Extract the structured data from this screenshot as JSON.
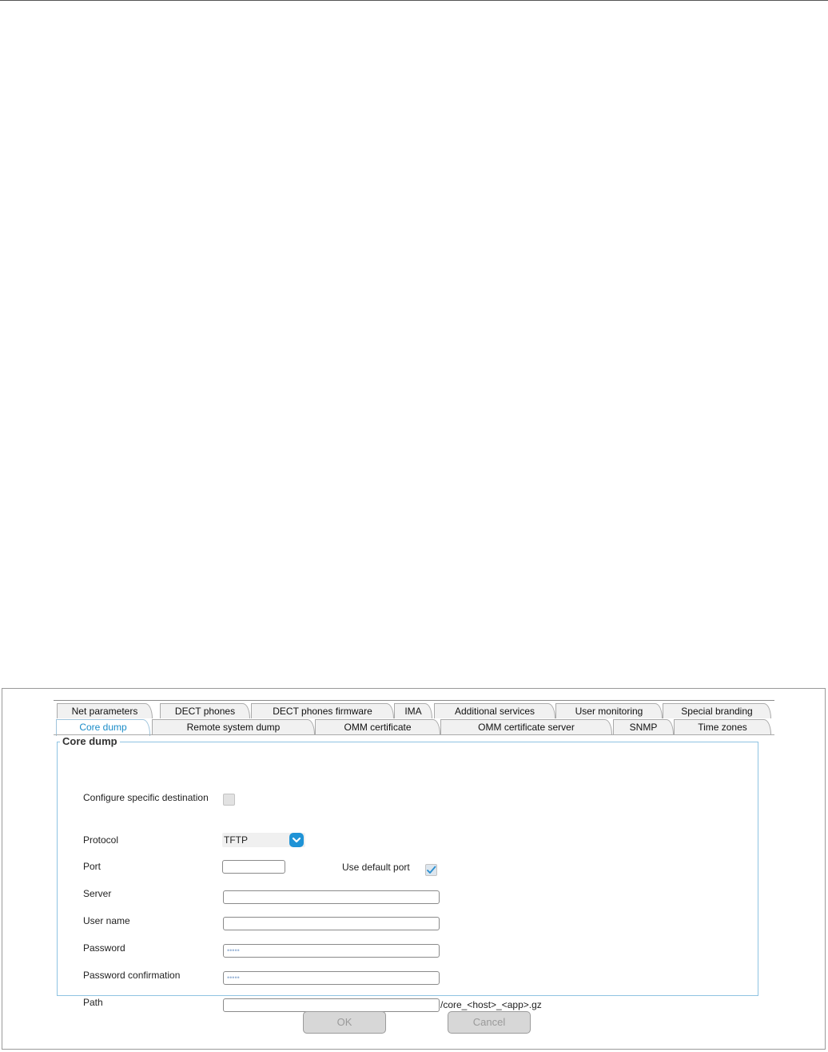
{
  "tabs": {
    "row1": [
      "Net parameters",
      "DECT phones",
      "DECT phones firmware",
      "IMA",
      "Additional services",
      "User monitoring",
      "Special branding"
    ],
    "row2": [
      "Core dump",
      "Remote system dump",
      "OMM certificate",
      "OMM certificate server",
      "SNMP",
      "Time zones"
    ],
    "active": "Core dump"
  },
  "group": {
    "title": "Core dump"
  },
  "form": {
    "configure_label": "Configure specific destination",
    "configure_checked": false,
    "protocol_label": "Protocol",
    "protocol_value": "TFTP",
    "port_label": "Port",
    "port_value": "",
    "use_default_port_label": "Use default port",
    "use_default_port_checked": true,
    "server_label": "Server",
    "server_value": "",
    "user_name_label": "User name",
    "user_name_value": "",
    "password_label": "Password",
    "password_value": "•••••",
    "password_confirm_label": "Password confirmation",
    "password_confirm_value": "•••••",
    "path_label": "Path",
    "path_value": "",
    "path_suffix": "/core_<host>_<app>.gz"
  },
  "buttons": {
    "ok_label": "OK",
    "cancel_label": "Cancel"
  },
  "colors": {
    "accent": "#1f93d6",
    "active_tab_text": "#1a8cc8",
    "group_border": "#8fc3e2"
  }
}
